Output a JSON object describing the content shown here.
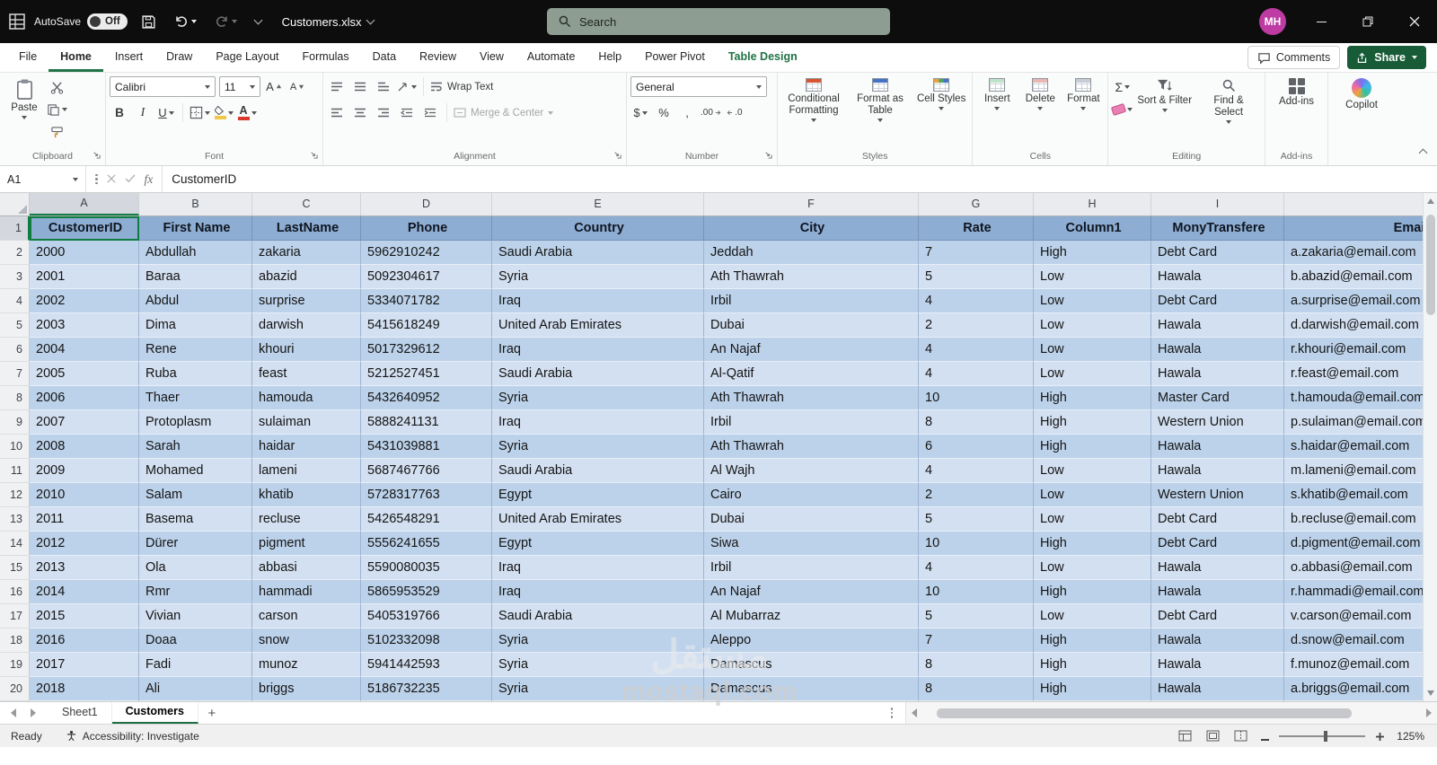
{
  "titlebar": {
    "autosave_label": "AutoSave",
    "autosave_state": "Off",
    "title": "Customers.xlsx",
    "search_placeholder": "Search",
    "avatar_initials": "MH"
  },
  "ribbon_tabs": {
    "tabs": [
      "File",
      "Home",
      "Insert",
      "Draw",
      "Page Layout",
      "Formulas",
      "Data",
      "Review",
      "View",
      "Automate",
      "Help",
      "Power Pivot",
      "Table Design"
    ],
    "active": "Home",
    "contextual": "Table Design",
    "comments": "Comments",
    "share": "Share"
  },
  "ribbon": {
    "paste": "Paste",
    "clipboard_label": "Clipboard",
    "font_name": "Calibri",
    "font_size": "11",
    "font_label": "Font",
    "wrap_text": "Wrap Text",
    "merge_center": "Merge & Center",
    "alignment_label": "Alignment",
    "number_format": "General",
    "number_label": "Number",
    "conditional_formatting": "Conditional Formatting",
    "format_as_table": "Format as Table",
    "cell_styles": "Cell Styles",
    "styles_label": "Styles",
    "insert": "Insert",
    "delete": "Delete",
    "format": "Format",
    "cells_label": "Cells",
    "sort_filter": "Sort & Filter",
    "find_select": "Find & Select",
    "editing_label": "Editing",
    "addins": "Add-ins",
    "addins_label": "Add-ins",
    "copilot": "Copilot"
  },
  "icons": {
    "bold": "B",
    "italic": "I",
    "underline": "U",
    "autosum": "Σ",
    "dollar": "$",
    "percent": "%",
    "comma": ",",
    "inc_decimal": ".00",
    "dec_decimal": ".0",
    "fx": "fx",
    "increase_font": "A",
    "decrease_font": "A",
    "font_color": "A",
    "orientation": "ab"
  },
  "formula_bar": {
    "name_box": "A1",
    "content": "CustomerID"
  },
  "grid": {
    "selected_cell": "A1",
    "column_letters": [
      "A",
      "B",
      "C",
      "D",
      "E",
      "F",
      "G",
      "H",
      "I",
      ""
    ],
    "header_row": [
      "CustomerID",
      "First Name",
      "LastName",
      "Phone",
      "Country",
      "City",
      "Rate",
      "Column1",
      "MonyTransfere",
      "Email"
    ],
    "rows": [
      [
        "2000",
        "Abdullah",
        "zakaria",
        "5962910242",
        "Saudi Arabia",
        "Jeddah",
        "7",
        "High",
        "Debt Card",
        "a.zakaria@email.com"
      ],
      [
        "2001",
        "Baraa",
        "abazid",
        "5092304617",
        "Syria",
        "Ath Thawrah",
        "5",
        "Low",
        "Hawala",
        "b.abazid@email.com"
      ],
      [
        "2002",
        "Abdul",
        "surprise",
        "5334071782",
        "Iraq",
        "Irbil",
        "4",
        "Low",
        "Debt Card",
        "a.surprise@email.com"
      ],
      [
        "2003",
        "Dima",
        "darwish",
        "5415618249",
        "United Arab Emirates",
        "Dubai",
        "2",
        "Low",
        "Hawala",
        "d.darwish@email.com"
      ],
      [
        "2004",
        "Rene",
        "khouri",
        "5017329612",
        "Iraq",
        "An Najaf",
        "4",
        "Low",
        "Hawala",
        "r.khouri@email.com"
      ],
      [
        "2005",
        "Ruba",
        "feast",
        "5212527451",
        "Saudi Arabia",
        "Al-Qatif",
        "4",
        "Low",
        "Hawala",
        "r.feast@email.com"
      ],
      [
        "2006",
        "Thaer",
        "hamouda",
        "5432640952",
        "Syria",
        "Ath Thawrah",
        "10",
        "High",
        "Master Card",
        "t.hamouda@email.com"
      ],
      [
        "2007",
        "Protoplasm",
        "sulaiman",
        "5888241131",
        "Iraq",
        "Irbil",
        "8",
        "High",
        "Western Union",
        "p.sulaiman@email.com"
      ],
      [
        "2008",
        "Sarah",
        "haidar",
        "5431039881",
        "Syria",
        "Ath Thawrah",
        "6",
        "High",
        "Hawala",
        "s.haidar@email.com"
      ],
      [
        "2009",
        "Mohamed",
        "lameni",
        "5687467766",
        "Saudi Arabia",
        "Al Wajh",
        "4",
        "Low",
        "Hawala",
        "m.lameni@email.com"
      ],
      [
        "2010",
        "Salam",
        "khatib",
        "5728317763",
        "Egypt",
        "Cairo",
        "2",
        "Low",
        "Western Union",
        "s.khatib@email.com"
      ],
      [
        "2011",
        "Basema",
        "recluse",
        "5426548291",
        "United Arab Emirates",
        "Dubai",
        "5",
        "Low",
        "Debt Card",
        "b.recluse@email.com"
      ],
      [
        "2012",
        "Dürer",
        "pigment",
        "5556241655",
        "Egypt",
        "Siwa",
        "10",
        "High",
        "Debt Card",
        "d.pigment@email.com"
      ],
      [
        "2013",
        "Ola",
        "abbasi",
        "5590080035",
        "Iraq",
        "Irbil",
        "4",
        "Low",
        "Hawala",
        "o.abbasi@email.com"
      ],
      [
        "2014",
        "Rmr",
        "hammadi",
        "5865953529",
        "Iraq",
        "An Najaf",
        "10",
        "High",
        "Hawala",
        "r.hammadi@email.com"
      ],
      [
        "2015",
        "Vivian",
        "carson",
        "5405319766",
        "Saudi Arabia",
        "Al Mubarraz",
        "5",
        "Low",
        "Debt Card",
        "v.carson@email.com"
      ],
      [
        "2016",
        "Doaa",
        "snow",
        "5102332098",
        "Syria",
        "Aleppo",
        "7",
        "High",
        "Hawala",
        "d.snow@email.com"
      ],
      [
        "2017",
        "Fadi",
        "munoz",
        "5941442593",
        "Syria",
        "Damascus",
        "8",
        "High",
        "Hawala",
        "f.munoz@email.com"
      ],
      [
        "2018",
        "Ali",
        "briggs",
        "5186732235",
        "Syria",
        "Damascus",
        "8",
        "High",
        "Hawala",
        "a.briggs@email.com"
      ]
    ]
  },
  "sheet_bar": {
    "tabs": [
      "Sheet1",
      "Customers"
    ],
    "active": "Customers",
    "add": "+"
  },
  "status_bar": {
    "ready": "Ready",
    "accessibility": "Accessibility: Investigate",
    "zoom": "125%"
  },
  "watermark": {
    "arabic": "مستقل",
    "latin": "mostaql.com"
  },
  "colors": {
    "excel_green": "#217346",
    "selection_green": "#107c41",
    "table_header": "#8eadd2",
    "band_dark": "#bcd2ea",
    "band_light": "#d3e0f1",
    "share_button": "#185c37",
    "avatar": "#bd3ba2"
  }
}
